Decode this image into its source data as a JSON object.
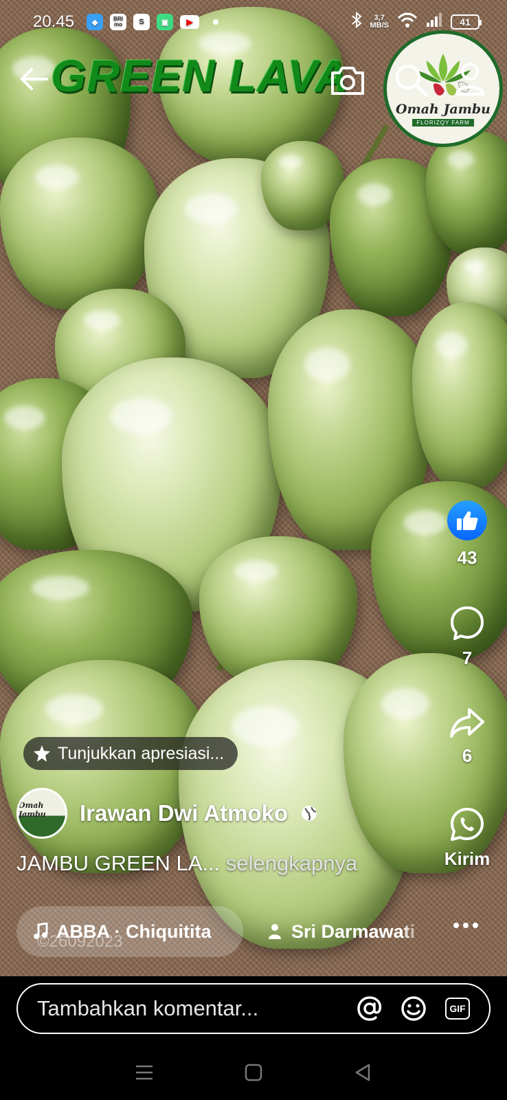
{
  "status_bar": {
    "time": "20.45",
    "app_icons": [
      "blue-app-icon",
      "brimo-icon",
      "shopee-icon",
      "green-app-icon",
      "youtube-icon"
    ],
    "brimo_label": "BRI mo",
    "net_speed_value": "3,7",
    "net_speed_unit": "MB/S",
    "battery": "41"
  },
  "top_bar": {
    "video_title": "GREEN LAVA",
    "icons": [
      "back-arrow-icon",
      "camera-icon",
      "search-icon",
      "profile-icon"
    ]
  },
  "brand_logo": {
    "name": "Omah Jambu",
    "sub": "FLORIZQY FARM"
  },
  "actions": {
    "likes": "43",
    "comments": "7",
    "shares": "6",
    "send_label": "Kirim"
  },
  "appreciation": {
    "label": "Tunjukkan apresiasi..."
  },
  "author": {
    "name": "Irawan Dwi Atmoko",
    "avatar_text": "Omah Jambu"
  },
  "caption": {
    "text": "JAMBU GREEN LA...",
    "more": "selengkapnya"
  },
  "music": {
    "label": "ABBA · Chiquitita",
    "watermark": "©26092023"
  },
  "tag": {
    "label": "Sri Darmawati"
  },
  "comment_bar": {
    "placeholder": "Tambahkan komentar...",
    "gif_label": "GIF"
  },
  "colors": {
    "title_green": "#118a1a",
    "like_blue": "#0866ff",
    "logo_green": "#1f6b2a"
  }
}
